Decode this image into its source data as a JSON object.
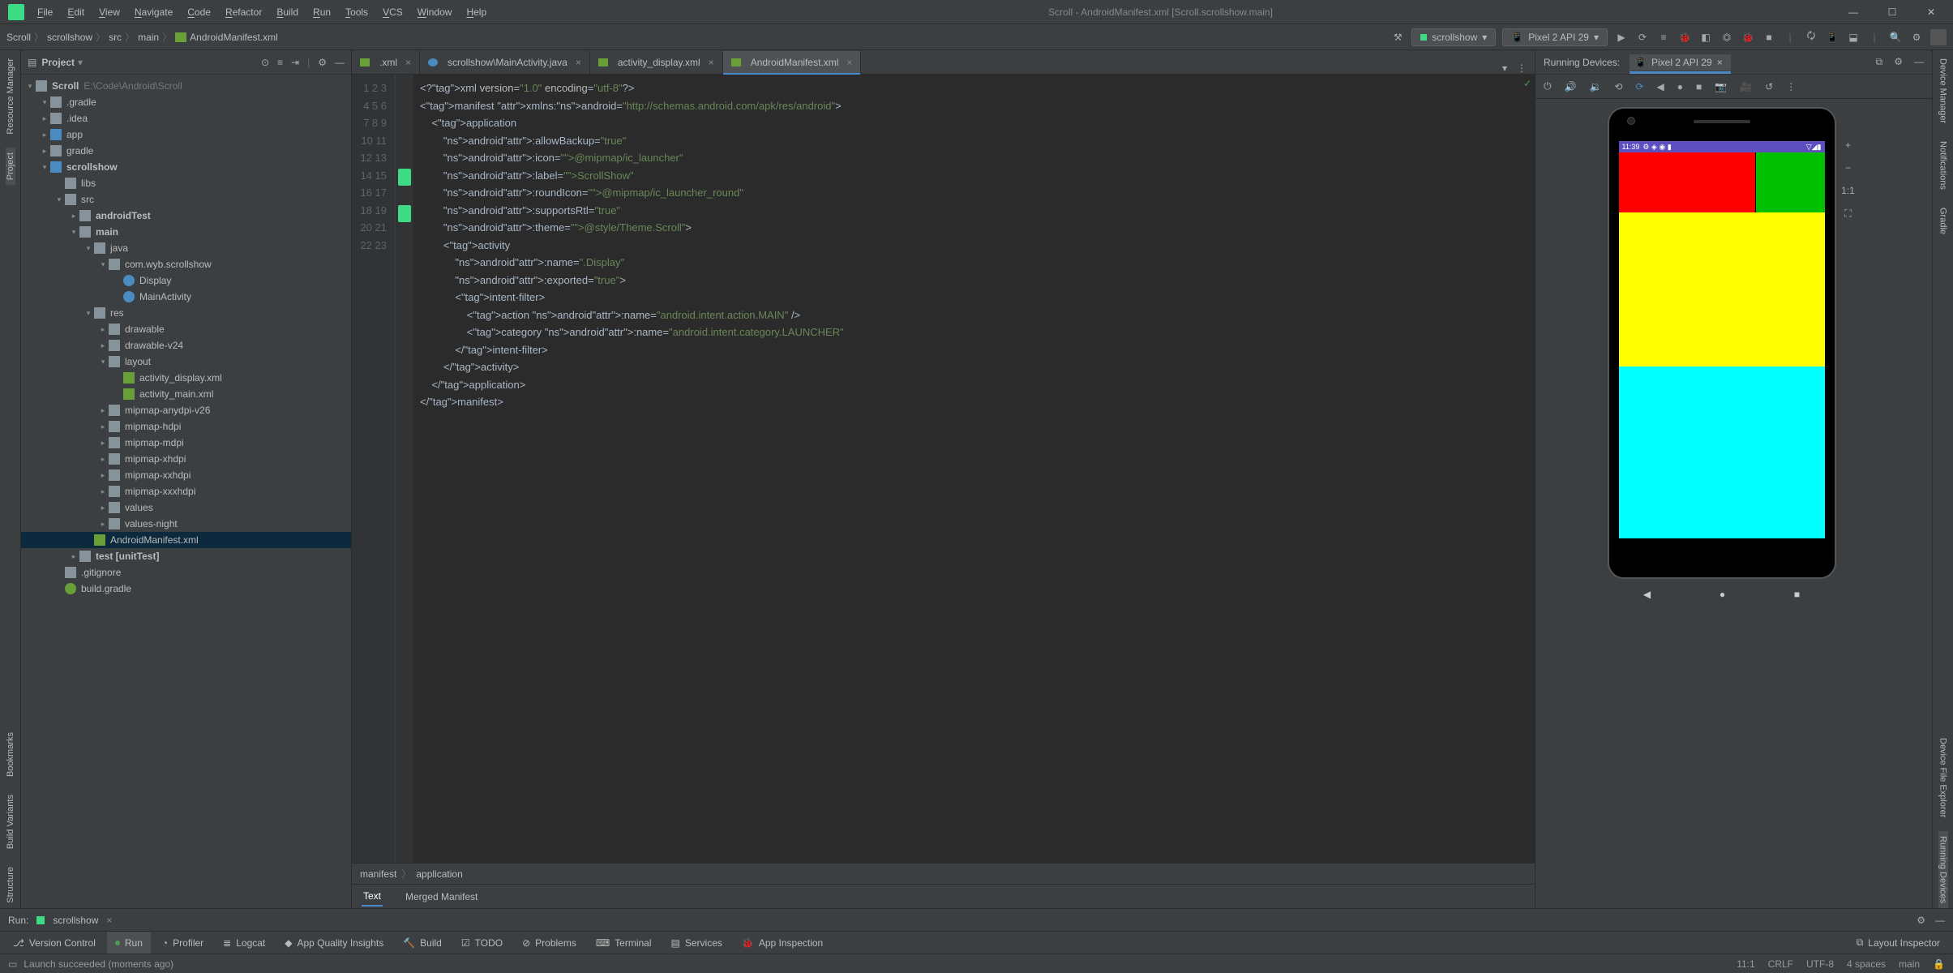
{
  "window": {
    "title": "Scroll - AndroidManifest.xml [Scroll.scrollshow.main]"
  },
  "menu": [
    "File",
    "Edit",
    "View",
    "Navigate",
    "Code",
    "Refactor",
    "Build",
    "Run",
    "Tools",
    "VCS",
    "Window",
    "Help"
  ],
  "breadcrumbs": [
    "Scroll",
    "scrollshow",
    "src",
    "main",
    "AndroidManifest.xml"
  ],
  "runConfig": {
    "name": "scrollshow",
    "device": "Pixel 2 API 29"
  },
  "leftTools": [
    "Resource Manager",
    "Project",
    "Bookmarks",
    "Build Variants",
    "Structure"
  ],
  "rightTools": [
    "Device Manager",
    "Notifications",
    "Gradle",
    "Device File Explorer",
    "Running Devices"
  ],
  "project": {
    "title": "Project",
    "rootName": "Scroll",
    "rootPath": "E:\\Code\\Android\\Scroll",
    "nodes": [
      {
        "d": 1,
        "a": "▾",
        "i": "folder",
        "t": ".gradle"
      },
      {
        "d": 1,
        "a": "▸",
        "i": "folder",
        "t": ".idea"
      },
      {
        "d": 1,
        "a": "▸",
        "i": "mod",
        "t": "app"
      },
      {
        "d": 1,
        "a": "▸",
        "i": "folder",
        "t": "gradle"
      },
      {
        "d": 1,
        "a": "▾",
        "i": "mod",
        "t": "scrollshow",
        "b": 1
      },
      {
        "d": 2,
        "a": " ",
        "i": "folder",
        "t": "libs"
      },
      {
        "d": 2,
        "a": "▾",
        "i": "folder",
        "t": "src"
      },
      {
        "d": 3,
        "a": "▸",
        "i": "folder",
        "t": "androidTest",
        "b": 1
      },
      {
        "d": 3,
        "a": "▾",
        "i": "folder",
        "t": "main",
        "b": 1
      },
      {
        "d": 4,
        "a": "▾",
        "i": "folder",
        "t": "java"
      },
      {
        "d": 5,
        "a": "▾",
        "i": "pkg",
        "t": "com.wyb.scrollshow"
      },
      {
        "d": 6,
        "a": " ",
        "i": "cls",
        "t": "Display"
      },
      {
        "d": 6,
        "a": " ",
        "i": "cls",
        "t": "MainActivity"
      },
      {
        "d": 4,
        "a": "▾",
        "i": "folder",
        "t": "res"
      },
      {
        "d": 5,
        "a": "▸",
        "i": "folder",
        "t": "drawable"
      },
      {
        "d": 5,
        "a": "▸",
        "i": "folder",
        "t": "drawable-v24"
      },
      {
        "d": 5,
        "a": "▾",
        "i": "folder",
        "t": "layout"
      },
      {
        "d": 6,
        "a": " ",
        "i": "xml",
        "t": "activity_display.xml"
      },
      {
        "d": 6,
        "a": " ",
        "i": "xml",
        "t": "activity_main.xml"
      },
      {
        "d": 5,
        "a": "▸",
        "i": "folder",
        "t": "mipmap-anydpi-v26"
      },
      {
        "d": 5,
        "a": "▸",
        "i": "folder",
        "t": "mipmap-hdpi"
      },
      {
        "d": 5,
        "a": "▸",
        "i": "folder",
        "t": "mipmap-mdpi"
      },
      {
        "d": 5,
        "a": "▸",
        "i": "folder",
        "t": "mipmap-xhdpi"
      },
      {
        "d": 5,
        "a": "▸",
        "i": "folder",
        "t": "mipmap-xxhdpi"
      },
      {
        "d": 5,
        "a": "▸",
        "i": "folder",
        "t": "mipmap-xxxhdpi"
      },
      {
        "d": 5,
        "a": "▸",
        "i": "folder",
        "t": "values"
      },
      {
        "d": 5,
        "a": "▸",
        "i": "folder",
        "t": "values-night"
      },
      {
        "d": 4,
        "a": " ",
        "i": "xml",
        "t": "AndroidManifest.xml",
        "sel": 1
      },
      {
        "d": 3,
        "a": "▸",
        "i": "folder",
        "t": "test [unitTest]",
        "b": 1
      },
      {
        "d": 2,
        "a": " ",
        "i": "git",
        "t": ".gitignore"
      },
      {
        "d": 2,
        "a": " ",
        "i": "grdl",
        "t": "build.gradle"
      }
    ]
  },
  "tabs": [
    {
      "label": ".xml",
      "icon": "xml"
    },
    {
      "label": "scrollshow\\MainActivity.java",
      "icon": "cls"
    },
    {
      "label": "activity_display.xml",
      "icon": "xml"
    },
    {
      "label": "AndroidManifest.xml",
      "icon": "xml",
      "active": true
    }
  ],
  "code": {
    "lines": 23,
    "currentLine": 11,
    "text": [
      "<?xml version=\"1.0\" encoding=\"utf-8\"?>",
      "<manifest xmlns:android=\"http://schemas.android.com/apk/res/android\">",
      "",
      "    <application",
      "        android:allowBackup=\"true\"",
      "        android:icon=\"@mipmap/ic_launcher\"",
      "        android:label=\"ScrollShow\"",
      "        android:roundIcon=\"@mipmap/ic_launcher_round\"",
      "        android:supportsRtl=\"true\"",
      "        android:theme=\"@style/Theme.Scroll\">",
      "",
      "        <activity",
      "            android:name=\".Display\"",
      "            android:exported=\"true\">",
      "            <intent-filter>",
      "                <action android:name=\"android.intent.action.MAIN\" />",
      "",
      "                <category android:name=\"android.intent.category.LAUNCHER\"",
      "            </intent-filter>",
      "        </activity>",
      "    </application>",
      "",
      "</manifest>"
    ]
  },
  "crumbs2": [
    "manifest",
    "application"
  ],
  "edTabs": [
    "Text",
    "Merged Manifest"
  ],
  "emulator": {
    "title": "Running Devices:",
    "tab": "Pixel 2 API 29",
    "statusTime": "11:39"
  },
  "runRow": {
    "label": "Run:",
    "name": "scrollshow"
  },
  "bottomTools": [
    "Version Control",
    "Run",
    "Profiler",
    "Logcat",
    "App Quality Insights",
    "Build",
    "TODO",
    "Problems",
    "Terminal",
    "Services",
    "App Inspection"
  ],
  "bottomRight": "Layout Inspector",
  "statusBar": {
    "msg": "Launch succeeded (moments ago)",
    "pos": "11:1",
    "eol": "CRLF",
    "enc": "UTF-8",
    "spc": "4 spaces",
    "branch": "main"
  }
}
